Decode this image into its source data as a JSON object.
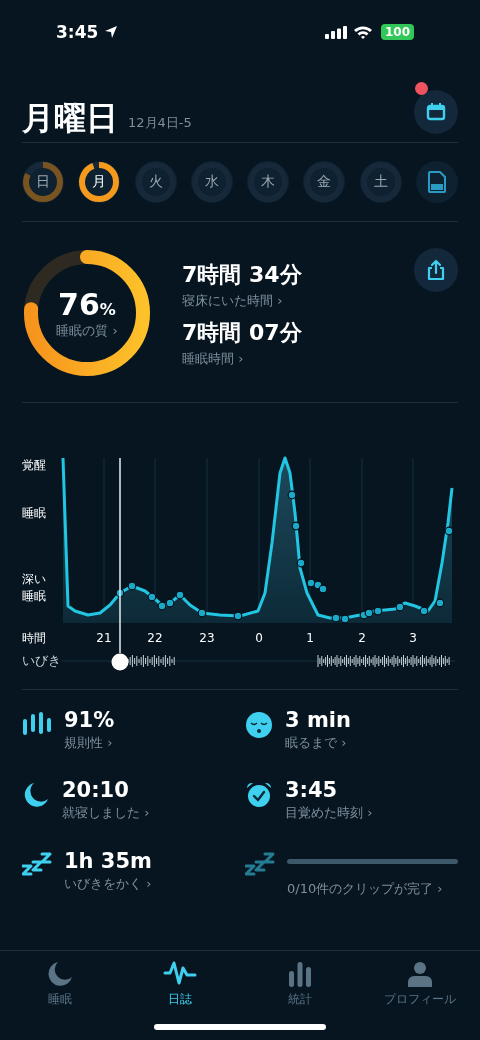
{
  "status_bar": {
    "time": "3:45",
    "battery": "100"
  },
  "header": {
    "title": "月曜日",
    "date": "12月4日-5",
    "calendar_badge": true
  },
  "days": [
    {
      "label": "日",
      "selected": false,
      "has_record": true
    },
    {
      "label": "月",
      "selected": true,
      "has_record": true
    },
    {
      "label": "火",
      "selected": false,
      "has_record": false
    },
    {
      "label": "水",
      "selected": false,
      "has_record": false
    },
    {
      "label": "木",
      "selected": false,
      "has_record": false
    },
    {
      "label": "金",
      "selected": false,
      "has_record": false
    },
    {
      "label": "土",
      "selected": false,
      "has_record": false
    }
  ],
  "summary": {
    "score": "76",
    "unit": "%",
    "score_label": "睡眠の質 ›",
    "items": [
      {
        "value": "7時間 34分",
        "label": "寝床にいた時間 ›"
      },
      {
        "value": "7時間 07分",
        "label": "睡眠時間 ›"
      }
    ]
  },
  "hypnogram": {
    "y_labels": [
      "覚醒",
      "睡眠",
      "深い睡眠"
    ],
    "x_title": "時間",
    "x_labels": [
      "21",
      "22",
      "23",
      "0",
      "1",
      "2",
      "3"
    ],
    "snore_label": "いびき"
  },
  "stats": [
    {
      "kind": "bars",
      "value": "91%",
      "label": "規則性 ›"
    },
    {
      "kind": "face",
      "value": "3 min",
      "label": "眠るまで ›"
    },
    {
      "kind": "moon",
      "value": "20:10",
      "label": "就寝しました ›"
    },
    {
      "kind": "alarm",
      "value": "3:45",
      "label": "目覚めた時刻 ›"
    },
    {
      "kind": "snore",
      "value": "1h 35m",
      "label": "いびきをかく ›"
    },
    {
      "kind": "clips",
      "label": "0/10件のクリップが完了 ›"
    }
  ],
  "tabs": [
    {
      "label": "睡眠",
      "kind": "moon",
      "selected": false
    },
    {
      "label": "日誌",
      "kind": "wave",
      "selected": true
    },
    {
      "label": "統計",
      "kind": "bars",
      "selected": false
    },
    {
      "label": "プロフィール",
      "kind": "person",
      "selected": false
    }
  ]
}
